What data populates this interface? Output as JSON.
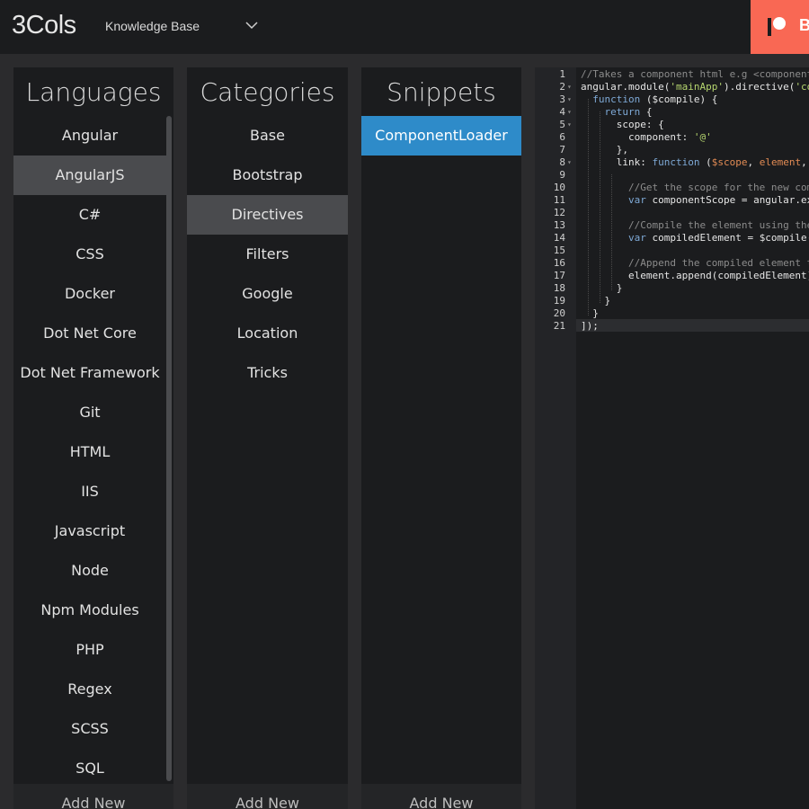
{
  "header": {
    "logo": "3Cols",
    "kb_select": "Knowledge Base",
    "patreon_label": "B"
  },
  "languages": {
    "title": "Languages",
    "items": [
      "Angular",
      "AngularJS",
      "C#",
      "CSS",
      "Docker",
      "Dot Net Core",
      "Dot Net Framework",
      "Git",
      "HTML",
      "IIS",
      "Javascript",
      "Node",
      "Npm Modules",
      "PHP",
      "Regex",
      "SCSS",
      "SQL"
    ],
    "selected": "AngularJS",
    "add_new": "Add New"
  },
  "categories": {
    "title": "Categories",
    "items": [
      "Base",
      "Bootstrap",
      "Directives",
      "Filters",
      "Google",
      "Location",
      "Tricks"
    ],
    "selected": "Directives",
    "add_new": "Add New"
  },
  "snippets": {
    "title": "Snippets",
    "items": [
      "ComponentLoader"
    ],
    "selected": "ComponentLoader",
    "add_new": "Add New"
  },
  "editor": {
    "lines": [
      {
        "n": "1",
        "fold": "",
        "indent": "",
        "parts": [
          [
            "c-com",
            "//Takes a component html e.g <component"
          ]
        ]
      },
      {
        "n": "2",
        "fold": "▾",
        "indent": "",
        "parts": [
          [
            "",
            "angular.module("
          ],
          [
            "c-str",
            "'mainApp'"
          ],
          [
            "",
            ").directive("
          ],
          [
            "c-str",
            "'co"
          ]
        ]
      },
      {
        "n": "3",
        "fold": "▾",
        "indent": "  ",
        "parts": [
          [
            "c-kw",
            "function"
          ],
          [
            "",
            " ($compile) {"
          ]
        ]
      },
      {
        "n": "4",
        "fold": "▾",
        "indent": "    ",
        "parts": [
          [
            "c-kw",
            "return"
          ],
          [
            "",
            " {"
          ]
        ]
      },
      {
        "n": "5",
        "fold": "▾",
        "indent": "      ",
        "parts": [
          [
            "",
            "scope: {"
          ]
        ]
      },
      {
        "n": "6",
        "fold": "",
        "indent": "        ",
        "parts": [
          [
            "",
            "component: "
          ],
          [
            "c-str",
            "'@'"
          ]
        ]
      },
      {
        "n": "7",
        "fold": "",
        "indent": "      ",
        "parts": [
          [
            "",
            "},"
          ]
        ]
      },
      {
        "n": "8",
        "fold": "▾",
        "indent": "      ",
        "parts": [
          [
            "",
            "link: "
          ],
          [
            "c-kw",
            "function"
          ],
          [
            "",
            " ("
          ],
          [
            "c-var",
            "$scope"
          ],
          [
            "",
            ", "
          ],
          [
            "c-var",
            "element"
          ],
          [
            "",
            ","
          ]
        ]
      },
      {
        "n": "9",
        "fold": "",
        "indent": "",
        "parts": []
      },
      {
        "n": "10",
        "fold": "",
        "indent": "        ",
        "parts": [
          [
            "c-com",
            "//Get the scope for the new com"
          ]
        ]
      },
      {
        "n": "11",
        "fold": "",
        "indent": "        ",
        "parts": [
          [
            "c-kw",
            "var"
          ],
          [
            "",
            " componentScope = angular.ex"
          ]
        ]
      },
      {
        "n": "12",
        "fold": "",
        "indent": "",
        "parts": []
      },
      {
        "n": "13",
        "fold": "",
        "indent": "        ",
        "parts": [
          [
            "c-com",
            "//Compile the element using the"
          ]
        ]
      },
      {
        "n": "14",
        "fold": "",
        "indent": "        ",
        "parts": [
          [
            "c-kw",
            "var"
          ],
          [
            "",
            " compiledElement = $compile("
          ]
        ]
      },
      {
        "n": "15",
        "fold": "",
        "indent": "",
        "parts": []
      },
      {
        "n": "16",
        "fold": "",
        "indent": "        ",
        "parts": [
          [
            "c-com",
            "//Append the compiled element t"
          ]
        ]
      },
      {
        "n": "17",
        "fold": "",
        "indent": "        ",
        "parts": [
          [
            "",
            "element.append(compiledElement)"
          ]
        ]
      },
      {
        "n": "18",
        "fold": "",
        "indent": "      ",
        "parts": [
          [
            "",
            "}"
          ]
        ]
      },
      {
        "n": "19",
        "fold": "",
        "indent": "    ",
        "parts": [
          [
            "",
            "}"
          ]
        ]
      },
      {
        "n": "20",
        "fold": "",
        "indent": "  ",
        "parts": [
          [
            "",
            "}"
          ]
        ]
      },
      {
        "n": "21",
        "fold": "",
        "indent": "",
        "parts": [
          [
            "",
            "]);"
          ]
        ]
      }
    ]
  }
}
